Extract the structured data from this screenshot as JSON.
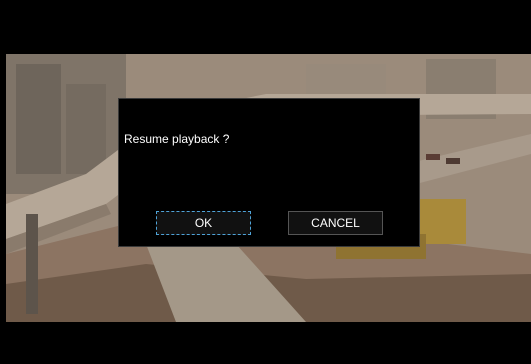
{
  "dialog": {
    "message": "Resume playback ?",
    "ok_label": "OK",
    "cancel_label": "CANCEL",
    "focused_button": "OK"
  },
  "colors": {
    "dialog_background": "#000000",
    "focus_outline": "#4fa3d8",
    "text": "#ffffff"
  }
}
